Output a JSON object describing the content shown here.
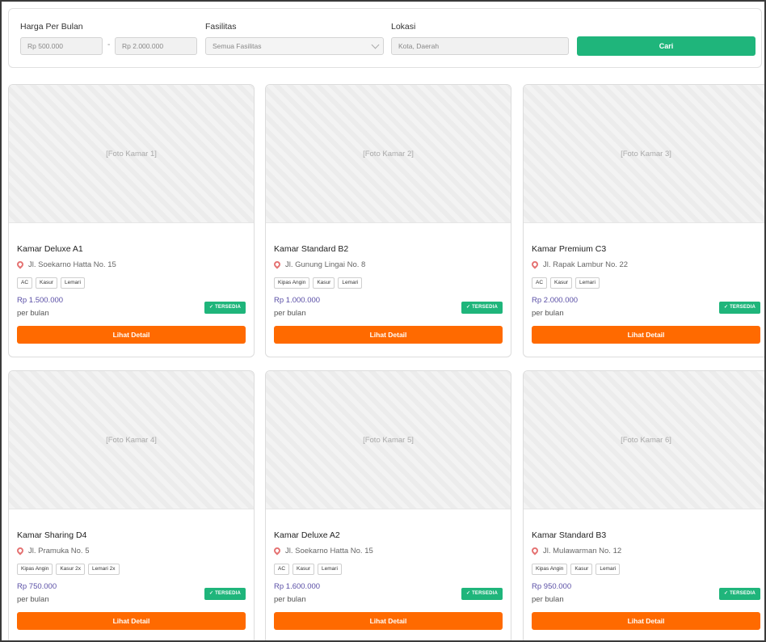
{
  "filters": {
    "price_label": "Harga Per Bulan",
    "price_min_placeholder": "Rp 500.000",
    "price_separator": "-",
    "price_max_placeholder": "Rp 2.000.000",
    "facility_label": "Fasilitas",
    "facility_selected": "Semua Fasilitas",
    "location_label": "Lokasi",
    "location_placeholder": "Kota, Daerah",
    "search_button": "Cari"
  },
  "colors": {
    "accent_green": "#1fb57b",
    "accent_orange": "#ff6a00",
    "price_color": "#5a4fa6"
  },
  "cards": [
    {
      "photo": "[Foto Kamar 1]",
      "title": "Kamar Deluxe A1",
      "location": "Jl. Soekarno Hatta No. 15",
      "tags": [
        "AC",
        "Kasur",
        "Lemari"
      ],
      "price": "Rp 1.500.000",
      "period": "per bulan",
      "status": "✓ TERSEDIA",
      "action": "Lihat Detail"
    },
    {
      "photo": "[Foto Kamar 2]",
      "title": "Kamar Standard B2",
      "location": "Jl. Gunung Lingai No. 8",
      "tags": [
        "Kipas Angin",
        "Kasur",
        "Lemari"
      ],
      "price": "Rp 1.000.000",
      "period": "per bulan",
      "status": "✓ TERSEDIA",
      "action": "Lihat Detail"
    },
    {
      "photo": "[Foto Kamar 3]",
      "title": "Kamar Premium C3",
      "location": "Jl. Rapak Lambur No. 22",
      "tags": [
        "AC",
        "Kasur",
        "Lemari"
      ],
      "price": "Rp 2.000.000",
      "period": "per bulan",
      "status": "✓ TERSEDIA",
      "action": "Lihat Detail"
    },
    {
      "photo": "[Foto Kamar 4]",
      "title": "Kamar Sharing D4",
      "location": "Jl. Pramuka No. 5",
      "tags": [
        "Kipas Angin",
        "Kasur 2x",
        "Lemari 2x"
      ],
      "price": "Rp 750.000",
      "period": "per bulan",
      "status": "✓ TERSEDIA",
      "action": "Lihat Detail"
    },
    {
      "photo": "[Foto Kamar 5]",
      "title": "Kamar Deluxe A2",
      "location": "Jl. Soekarno Hatta No. 15",
      "tags": [
        "AC",
        "Kasur",
        "Lemari"
      ],
      "price": "Rp 1.600.000",
      "period": "per bulan",
      "status": "✓ TERSEDIA",
      "action": "Lihat Detail"
    },
    {
      "photo": "[Foto Kamar 6]",
      "title": "Kamar Standard B3",
      "location": "Jl. Mulawarman No. 12",
      "tags": [
        "Kipas Angin",
        "Kasur",
        "Lemari"
      ],
      "price": "Rp 950.000",
      "period": "per bulan",
      "status": "✓ TERSEDIA",
      "action": "Lihat Detail"
    }
  ]
}
